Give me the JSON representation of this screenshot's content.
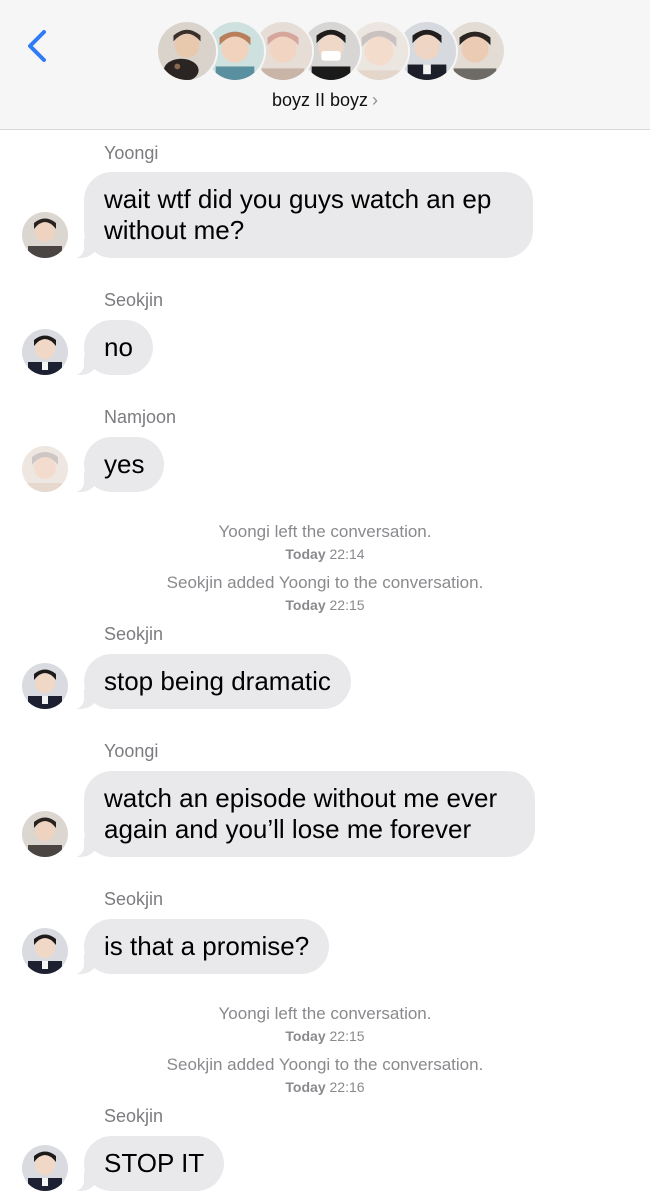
{
  "header": {
    "title": "boyz II boyz",
    "chevron": "›",
    "back_icon": "chevron-left-icon",
    "accent_color": "#2f7cf6",
    "participants": [
      {
        "icon": "avatar-photo"
      },
      {
        "icon": "avatar-photo"
      },
      {
        "icon": "avatar-photo"
      },
      {
        "icon": "avatar-photo"
      },
      {
        "icon": "avatar-photo"
      },
      {
        "icon": "avatar-photo"
      },
      {
        "icon": "avatar-photo"
      }
    ]
  },
  "messages": {
    "m1": {
      "sender": "Yoongi",
      "text_lines": [
        "wait wtf did you guys watch an ep",
        "without me?"
      ]
    },
    "m2": {
      "sender": "Seokjin",
      "text": "no"
    },
    "m3": {
      "sender": "Namjoon",
      "text": "yes"
    },
    "s1": {
      "text": "Yoongi left the conversation.",
      "day": "Today",
      "time": "22:14"
    },
    "s2": {
      "text": "Seokjin added Yoongi to the conversation.",
      "day": "Today",
      "time": "22:15"
    },
    "m4": {
      "sender": "Seokjin",
      "text": "stop being dramatic"
    },
    "m5": {
      "sender": "Yoongi",
      "text_lines": [
        "watch an episode without me ever",
        "again and you’ll lose me forever"
      ]
    },
    "m6": {
      "sender": "Seokjin",
      "text": "is that a promise?"
    },
    "s3": {
      "text": "Yoongi left the conversation.",
      "day": "Today",
      "time": "22:15"
    },
    "s4": {
      "text": "Seokjin added Yoongi to the conversation.",
      "day": "Today",
      "time": "22:16"
    },
    "m7": {
      "sender": "Seokjin",
      "text": "STOP IT"
    }
  },
  "colors": {
    "bubble": "#e9e9eb",
    "secondary_text": "#8a8a8e",
    "header_bg": "#f6f6f7"
  }
}
